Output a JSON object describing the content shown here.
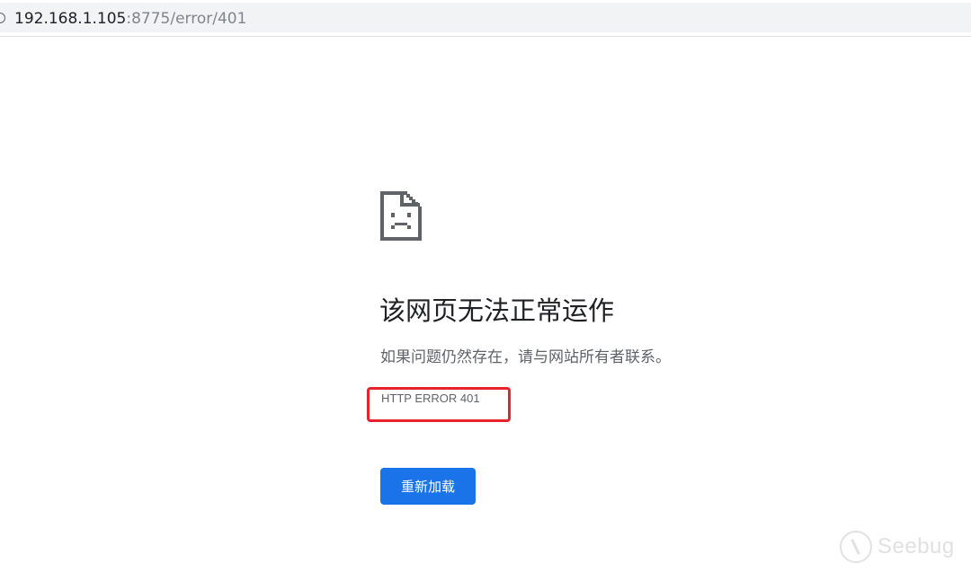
{
  "address_bar": {
    "url_host": "192.168.1.105",
    "url_path": ":8775/error/401"
  },
  "error_page": {
    "icon": "sad-page-icon",
    "title": "该网页无法正常运作",
    "description": "如果问题仍然存在，请与网站所有者联系。",
    "error_code": "HTTP ERROR 401",
    "reload_button": "重新加载"
  },
  "watermark": {
    "text": "Seebug"
  },
  "colors": {
    "button": "#1a73e8",
    "highlight_box": "#e8232b"
  }
}
